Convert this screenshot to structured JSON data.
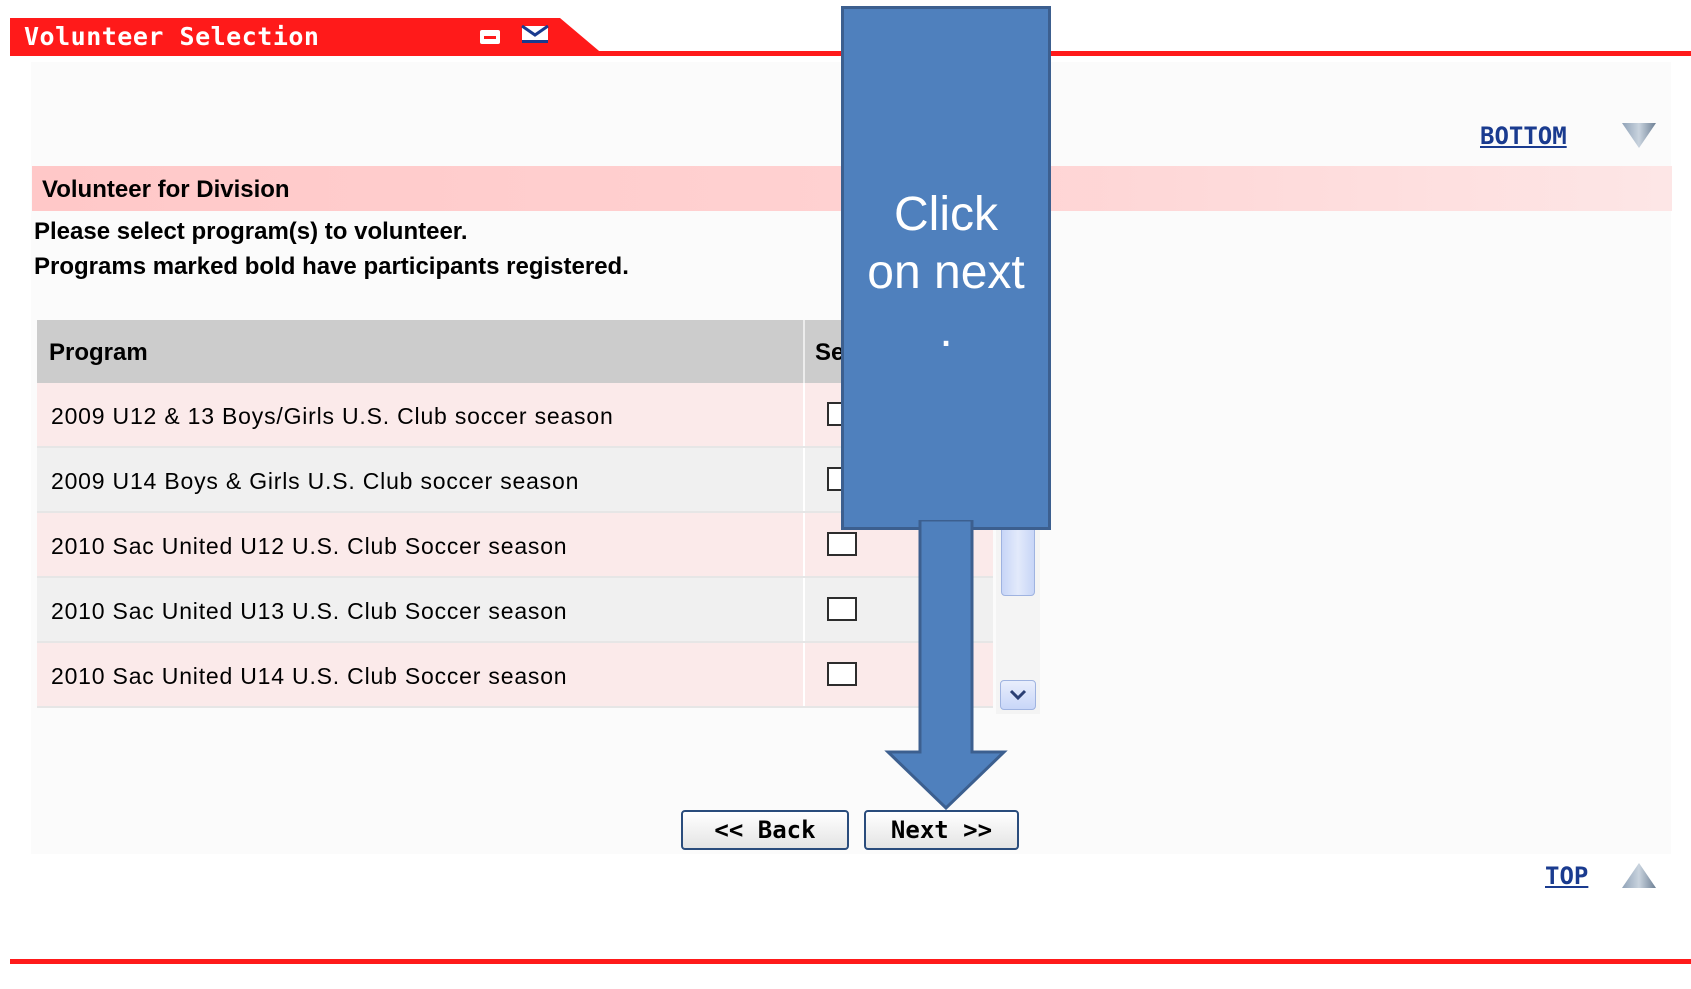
{
  "window": {
    "title": "Volunteer Selection"
  },
  "nav": {
    "bottom_label": "BOTTOM",
    "top_label": "TOP"
  },
  "section": {
    "title": "Volunteer for Division",
    "instruction_1": "Please select program(s) to volunteer.",
    "instruction_2": "Programs marked bold have participants registered."
  },
  "table": {
    "header_program": "Program",
    "header_select_partial": "Se",
    "rows": [
      {
        "program": "2009 U12 & 13 Boys/Girls U.S. Club soccer season",
        "checked": false
      },
      {
        "program": "2009 U14 Boys & Girls U.S. Club soccer season",
        "checked": false
      },
      {
        "program": "2010 Sac United U12 U.S. Club Soccer season",
        "checked": false
      },
      {
        "program": "2010 Sac United U13 U.S. Club Soccer season",
        "checked": false
      },
      {
        "program": "2010 Sac United U14 U.S. Club Soccer season",
        "checked": false
      }
    ]
  },
  "buttons": {
    "back_label": "<< Back",
    "next_label": "Next >>"
  },
  "callout": {
    "line1": "Click",
    "line2": "on next",
    "line3": "."
  },
  "colors": {
    "header_red": "#ff1a1a",
    "section_band": "#ffc8c8",
    "link_blue": "#1a3b8f",
    "callout_blue": "#4f80bd",
    "table_header_gray": "#cccccc"
  },
  "icons": {
    "minimize": "minimize-icon",
    "email": "email-icon",
    "bottom": "triangle-down-icon",
    "top": "triangle-up-icon",
    "scroll_down": "chevron-down-icon"
  }
}
